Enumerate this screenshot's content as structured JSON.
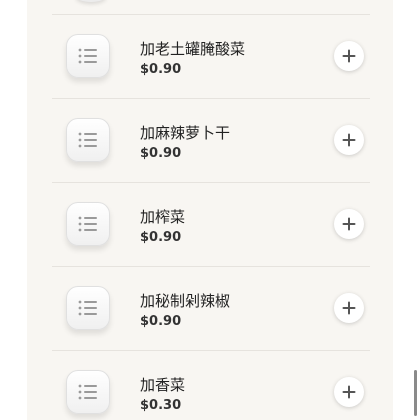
{
  "menu": {
    "items": [
      {
        "name": "加老土罐腌酸菜",
        "price": "$0.90",
        "icon": "list-icon",
        "action_icon": "plus-icon"
      },
      {
        "name": "加麻辣萝卜干",
        "price": "$0.90",
        "icon": "list-icon",
        "action_icon": "plus-icon"
      },
      {
        "name": "加榨菜",
        "price": "$0.90",
        "icon": "list-icon",
        "action_icon": "plus-icon"
      },
      {
        "name": "加秘制剁辣椒",
        "price": "$0.90",
        "icon": "list-icon",
        "action_icon": "plus-icon"
      },
      {
        "name": "加香菜",
        "price": "$0.30",
        "icon": "list-icon",
        "action_icon": "plus-icon"
      }
    ]
  },
  "colors": {
    "panel_background": "#f8f6f2",
    "divider": "#e6e3de",
    "text_primary": "#222222",
    "icon_gray": "#9a9a9a"
  }
}
